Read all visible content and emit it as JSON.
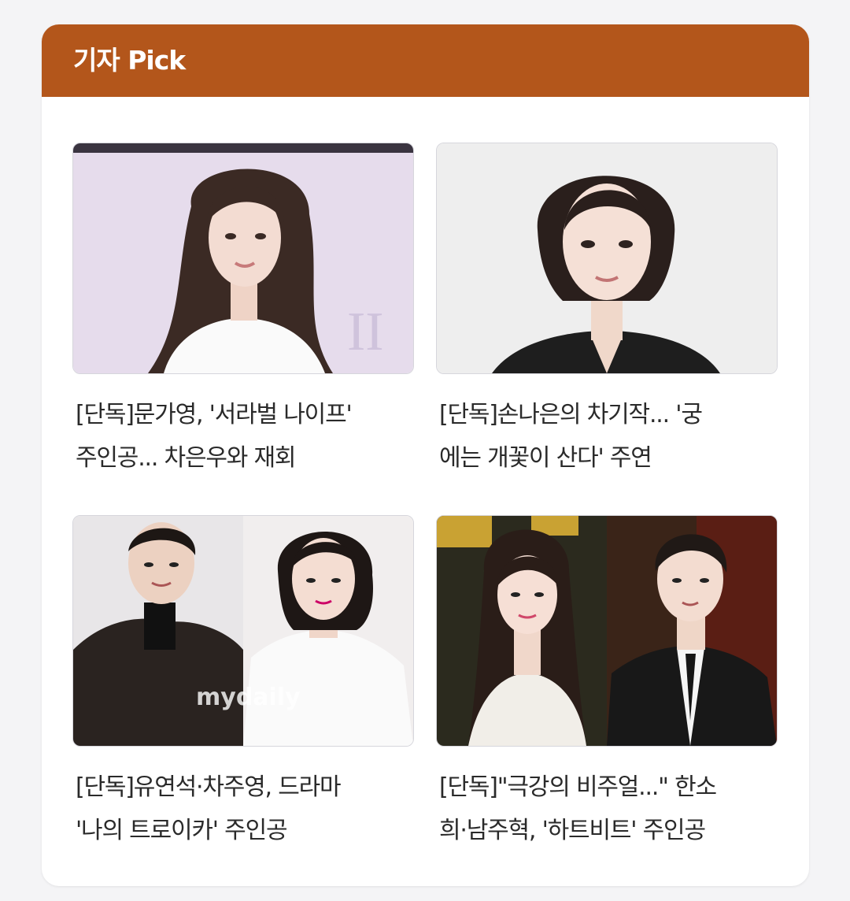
{
  "section": {
    "title": "기자 Pick",
    "accent_color": "#b3561b"
  },
  "articles": [
    {
      "thumbnail_icon": "portrait-photo",
      "headline_lines": [
        "[단독]문가영, '서라벌 나이프'",
        "주인공... 차은우와 재회"
      ]
    },
    {
      "thumbnail_icon": "portrait-photo",
      "headline_lines": [
        "[단독]손나은의 차기작... '궁",
        "에는 개꽃이 산다' 주연"
      ]
    },
    {
      "thumbnail_icon": "two-person-photo",
      "watermark": "mydaily",
      "headline_lines": [
        "[단독]유연석·차주영, 드라마",
        "'나의 트로이카' 주인공"
      ]
    },
    {
      "thumbnail_icon": "two-person-photo",
      "headline_lines": [
        "[단독]\"극강의 비주얼...\" 한소",
        "희·남주혁, '하트비트' 주인공"
      ]
    }
  ]
}
